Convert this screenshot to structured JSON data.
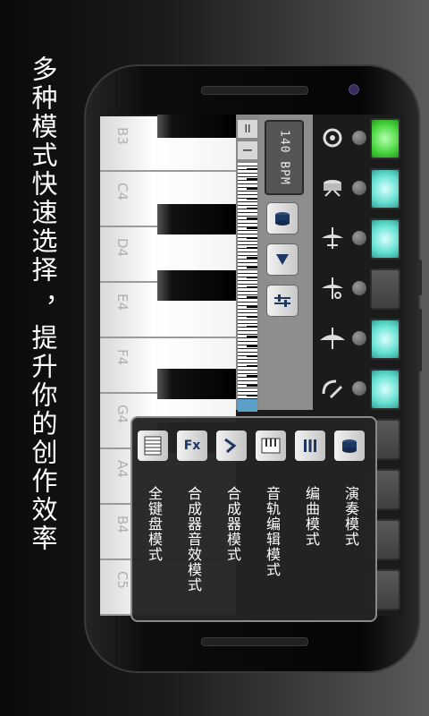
{
  "promo_text": "多种模式快速选择 ，提升你的创作效率",
  "piano": {
    "keys": [
      "B3",
      "C4",
      "D4",
      "E4",
      "F4",
      "G4",
      "A4",
      "B4",
      "C5"
    ]
  },
  "controls": {
    "bpm_text": "140 BPM",
    "drum_button_icon": "drum-icon",
    "play_button_icon": "play-icon",
    "mixer_button_icon": "mixer-icon"
  },
  "drum_rows": [
    {
      "icon": "bass-drum-icon",
      "pad": "green"
    },
    {
      "icon": "snare-drum-icon",
      "pad": "cyan"
    },
    {
      "icon": "hihat-closed-icon",
      "pad": "cyan"
    },
    {
      "icon": "hihat-open-icon",
      "pad": "off"
    },
    {
      "icon": "cymbal-icon",
      "pad": "cyan"
    },
    {
      "icon": "tom-icon",
      "pad": "cyan"
    }
  ],
  "menu": {
    "items": [
      {
        "label": "演奏模式",
        "icon": "drum-mode-icon"
      },
      {
        "label": "编曲模式",
        "icon": "sequencer-icon"
      },
      {
        "label": "音轨编辑模式",
        "icon": "track-keyboard-icon"
      },
      {
        "label": "合成器模式",
        "icon": "waveform-icon"
      },
      {
        "label": "合成器音效模式",
        "icon": "fx-icon"
      },
      {
        "label": "全键盘模式",
        "icon": "full-keyboard-icon"
      }
    ]
  },
  "colors": {
    "pad_green": "#49d63f",
    "pad_cyan": "#63e0d2",
    "menu_bg": "#242424"
  }
}
